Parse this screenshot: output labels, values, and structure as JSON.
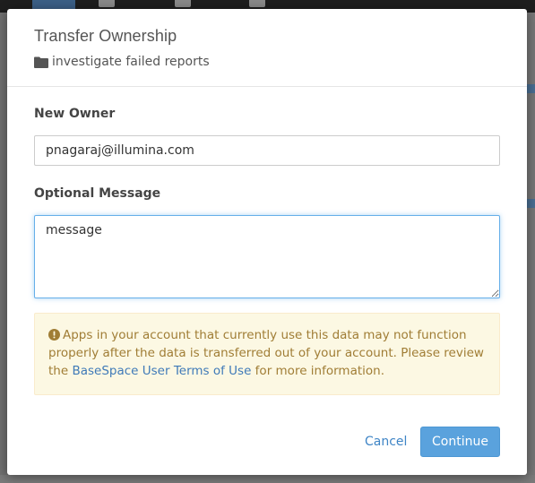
{
  "dialog": {
    "title": "Transfer Ownership",
    "subtitle": "investigate failed reports",
    "subtitle_icon": "folder-icon"
  },
  "form": {
    "owner_label": "New Owner",
    "owner_value": "pnagaraj@illumina.com",
    "message_label": "Optional Message",
    "message_value": "message"
  },
  "alert": {
    "icon": "exclamation-circle-icon",
    "text_before": "Apps in your account that currently use this data may not function properly after the data is transferred out of your account. Please review the ",
    "link_text": "BaseSpace User Terms of Use",
    "text_after": " for more information."
  },
  "footer": {
    "cancel_label": "Cancel",
    "continue_label": "Continue"
  },
  "colors": {
    "primary": "#5aa2dd",
    "link": "#3f85c6",
    "warning_bg": "#fcf8e3",
    "warning_text": "#a07d35"
  }
}
